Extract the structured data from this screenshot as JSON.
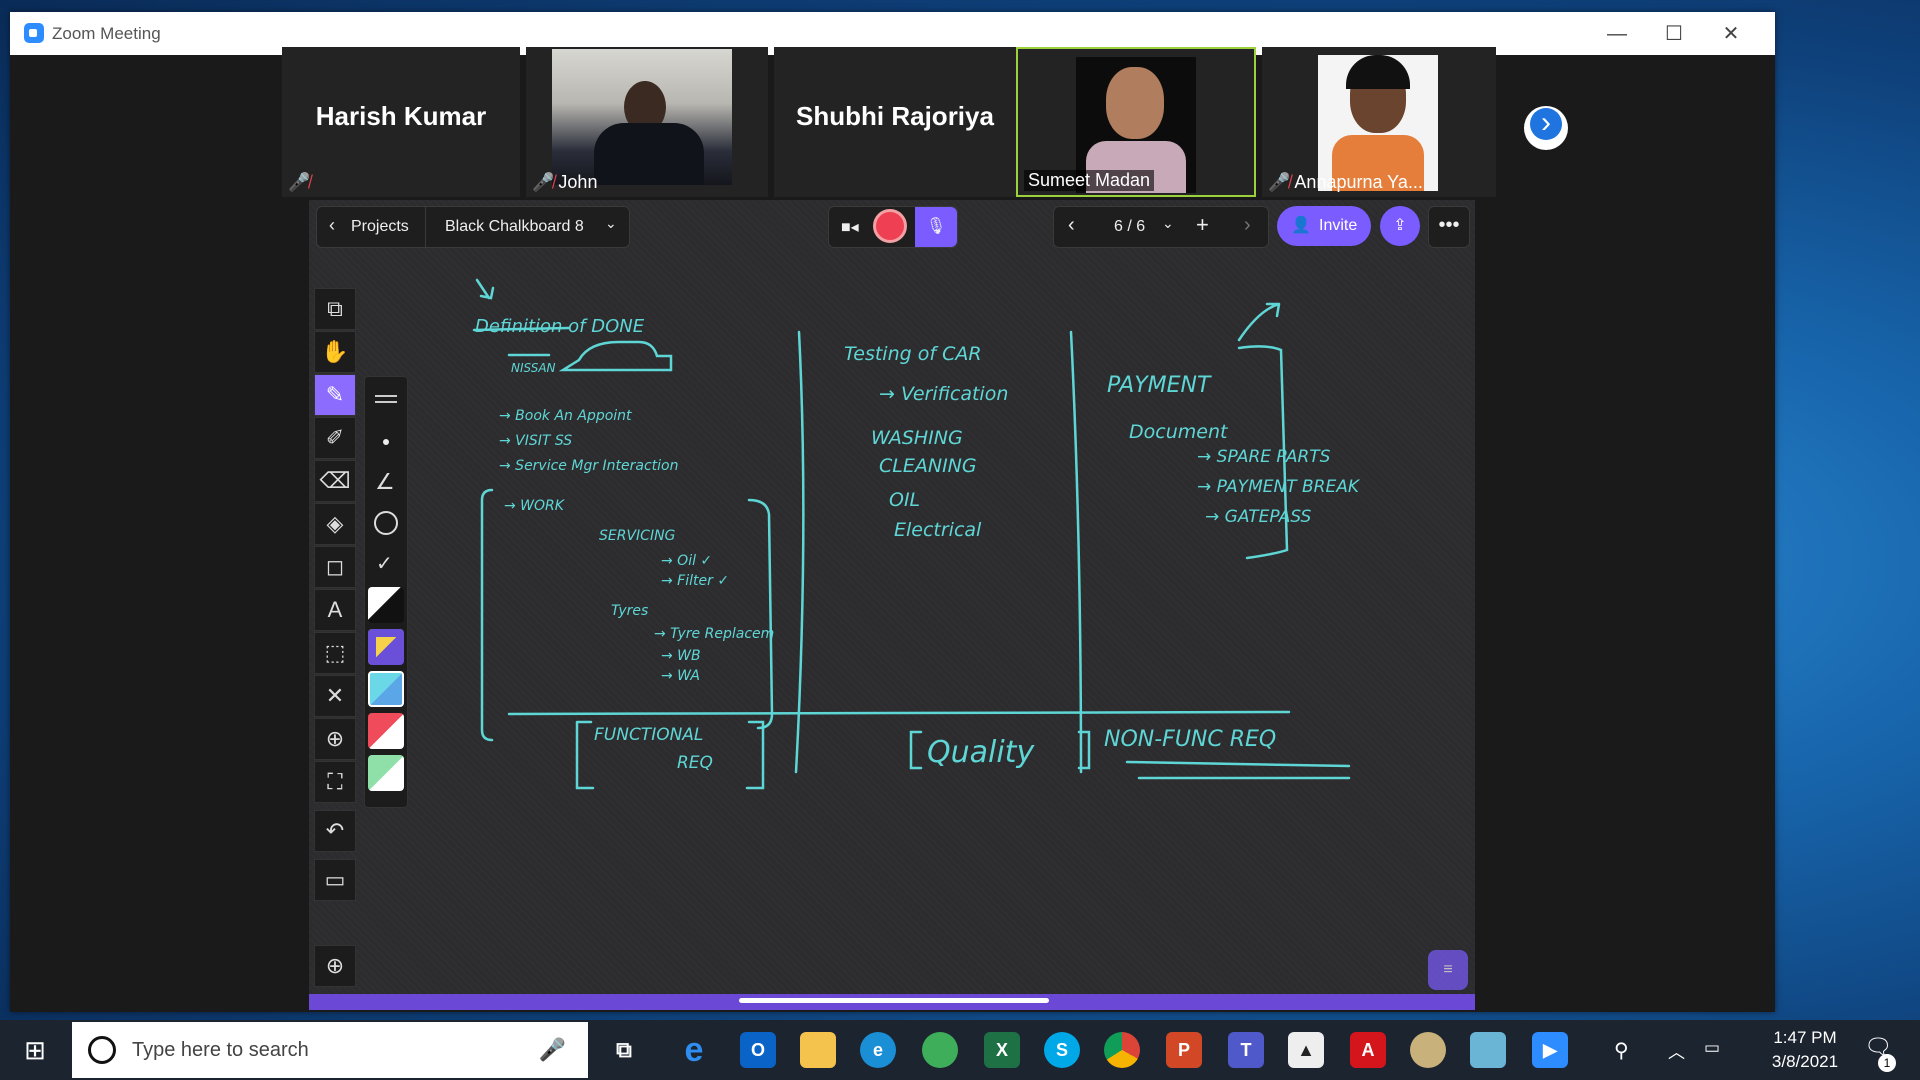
{
  "window": {
    "title": "Zoom Meeting",
    "minimize": "—",
    "maximize": "☐",
    "close": "✕"
  },
  "participants": [
    {
      "name": "Harish Kumar",
      "muted": true
    },
    {
      "name": "John",
      "muted": true
    },
    {
      "name": "Shubhi Rajoriya",
      "muted": false
    },
    {
      "name": "Sumeet Madan",
      "muted": false,
      "speaking": true
    },
    {
      "name": "Annapurna Ya...",
      "muted": true
    }
  ],
  "toolbar": {
    "projects_label": "Projects",
    "board_name": "Black Chalkboard 8",
    "page_indicator": "6 / 6",
    "invite_label": "Invite"
  },
  "board": {
    "col1": {
      "heading": "Definition of DONE",
      "sub": "NISSAN",
      "items": [
        "→ Book An Appoint",
        "→ VISIT SS",
        "→ Service Mgr Interaction"
      ],
      "work": "→ WORK",
      "servicing": "SERVICING",
      "servicing_items": [
        "→ Oil ✓",
        "→ Filter ✓"
      ],
      "tyres": "Tyres",
      "tyre_items": [
        "→ Tyre Replacem",
        "→ WB",
        "→ WA"
      ],
      "footer": [
        "FUNCTIONAL",
        "REQ"
      ]
    },
    "col2": {
      "heading": "Testing of CAR",
      "items": [
        "→ Verification",
        "WASHING",
        "CLEANING",
        "OIL",
        "Electrical"
      ],
      "footer": "Quality"
    },
    "col3": {
      "heading": "PAYMENT",
      "sub": "Document",
      "items": [
        "→ SPARE PARTS",
        "→ PAYMENT BREAK",
        "→ GATEPASS"
      ],
      "footer": "NON-FUNC REQ"
    }
  },
  "taskbar": {
    "search_placeholder": "Type here to search",
    "time": "1:47 PM",
    "date": "3/8/2021",
    "notifications_count": "1",
    "apps": [
      "task-view",
      "internet-explorer",
      "outlook",
      "file-explorer",
      "edge",
      "globe",
      "excel",
      "skype",
      "chrome",
      "powerpoint",
      "teams",
      "photos",
      "acrobat",
      "paint",
      "notepad",
      "zoom"
    ]
  },
  "colors": {
    "ink": "#5fd6d6",
    "accent": "#7b5cff",
    "zoom_blue": "#2d8cff"
  }
}
